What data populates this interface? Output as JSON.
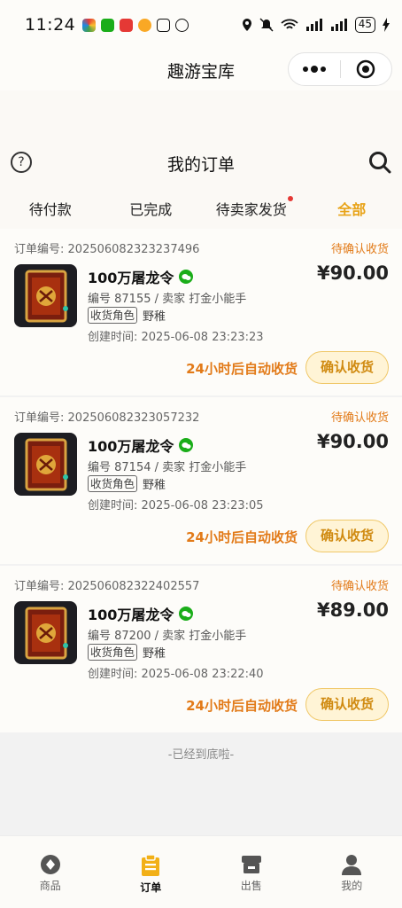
{
  "status_bar": {
    "time": "11:24",
    "battery": "45"
  },
  "nav": {
    "title": "趣游宝库"
  },
  "header": {
    "title": "我的订单"
  },
  "tabs": [
    {
      "label": "待付款"
    },
    {
      "label": "已完成"
    },
    {
      "label": "待卖家发货"
    },
    {
      "label": "全部"
    }
  ],
  "orders": [
    {
      "order_label": "订单编号:",
      "order_no": "202506082323237496",
      "status": "待确认收货",
      "title": "100万屠龙令",
      "price": "¥90.00",
      "meta": "编号 87155 / 卖家 打金小能手",
      "role_tag": "收货角色",
      "role_name": "野稚",
      "created": "创建时间:  2025-06-08 23:23:23",
      "auto_receive": "24小时后自动收货",
      "confirm": "确认收货"
    },
    {
      "order_label": "订单编号:",
      "order_no": "202506082323057232",
      "status": "待确认收货",
      "title": "100万屠龙令",
      "price": "¥90.00",
      "meta": "编号 87154 / 卖家 打金小能手",
      "role_tag": "收货角色",
      "role_name": "野稚",
      "created": "创建时间:  2025-06-08 23:23:05",
      "auto_receive": "24小时后自动收货",
      "confirm": "确认收货"
    },
    {
      "order_label": "订单编号:",
      "order_no": "202506082322402557",
      "status": "待确认收货",
      "title": "100万屠龙令",
      "price": "¥89.00",
      "meta": "编号 87200 / 卖家 打金小能手",
      "role_tag": "收货角色",
      "role_name": "野稚",
      "created": "创建时间:  2025-06-08 23:22:40",
      "auto_receive": "24小时后自动收货",
      "confirm": "确认收货"
    }
  ],
  "end_text": "-已经到底啦-",
  "tabbar": [
    {
      "label": "商品",
      "icon": "diamond-icon"
    },
    {
      "label": "订单",
      "icon": "clipboard-icon"
    },
    {
      "label": "出售",
      "icon": "store-icon"
    },
    {
      "label": "我的",
      "icon": "user-icon"
    }
  ],
  "colors": {
    "accent": "#e8a317",
    "status": "#e27a18",
    "wechat": "#1aad19"
  }
}
